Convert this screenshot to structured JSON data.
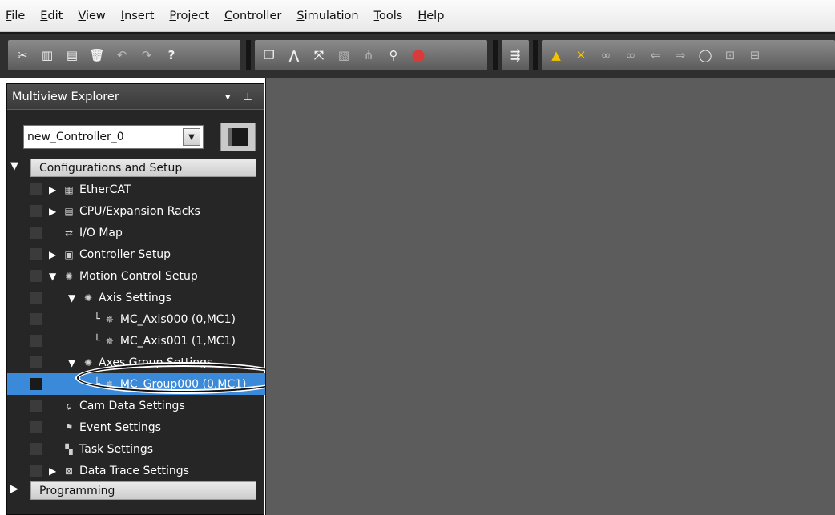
{
  "menubar": {
    "items": [
      "File",
      "Edit",
      "View",
      "Insert",
      "Project",
      "Controller",
      "Simulation",
      "Tools",
      "Help"
    ],
    "underline": [
      "F",
      "E",
      "V",
      "I",
      "P",
      "C",
      "S",
      "T",
      "H"
    ]
  },
  "toolbar": {
    "icons": [
      "cut-icon",
      "copy-icon",
      "paste-icon",
      "delete-icon",
      "undo-icon",
      "redo-icon",
      "help-icon",
      "window-icon",
      "build-icon",
      "cross-reference-icon",
      "compare-icon",
      "register-icon",
      "search-icon",
      "error-icon",
      "online-icon",
      "warning-icon",
      "stop-icon",
      "monitor-icon",
      "monitor-off-icon",
      "upload-icon",
      "download-icon",
      "refresh-icon",
      "simulate-icon",
      "simulate-stop-icon"
    ]
  },
  "explorer": {
    "title": "Multiview Explorer",
    "title_controls": "▾ ⊥",
    "controller": "new_Controller_0",
    "sections": {
      "config": "Configurations and Setup",
      "programming": "Programming"
    },
    "tree": {
      "ethercat": "EtherCAT",
      "cpu_racks": "CPU/Expansion Racks",
      "io_map": "I/O Map",
      "controller_setup": "Controller Setup",
      "motion_control": "Motion Control Setup",
      "axis_settings": "Axis Settings",
      "axis0": "MC_Axis000 (0,MC1)",
      "axis1": "MC_Axis001 (1,MC1)",
      "axes_group": "Axes Group Settings",
      "group0": "MC_Group000 (0,MC1)",
      "cam_data": "Cam Data Settings",
      "event_settings": "Event Settings",
      "task_settings": "Task Settings",
      "data_trace": "Data Trace Settings"
    }
  },
  "colors": {
    "selected": "#3b8ad9",
    "panel": "#262626",
    "workspace": "#5c5c5c"
  }
}
